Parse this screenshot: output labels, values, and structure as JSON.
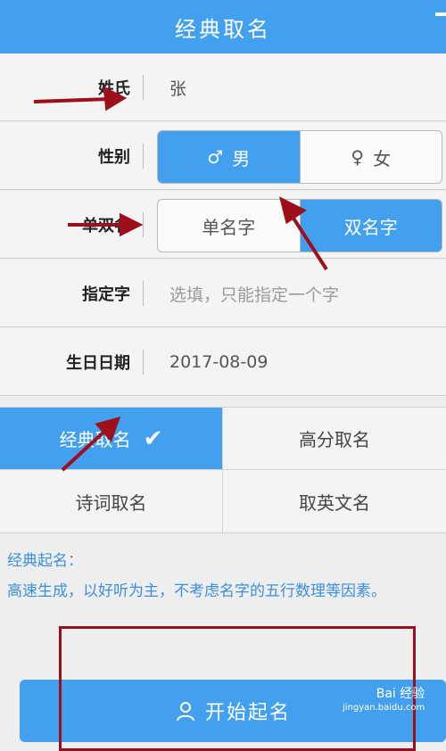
{
  "header": {
    "title": "经典取名"
  },
  "form": {
    "surname": {
      "label": "姓氏",
      "value": "张"
    },
    "gender": {
      "label": "性别",
      "options": [
        {
          "label": "男",
          "icon": "male-symbol-icon",
          "active": true
        },
        {
          "label": "女",
          "icon": "female-symbol-icon",
          "active": false
        }
      ]
    },
    "name_length": {
      "label": "单双名",
      "options": [
        {
          "label": "单名字",
          "active": false
        },
        {
          "label": "双名字",
          "active": true
        }
      ]
    },
    "specified_char": {
      "label": "指定字",
      "placeholder": "选填，只能指定一个字"
    },
    "birthday": {
      "label": "生日日期",
      "value": "2017-08-09"
    }
  },
  "tabs": [
    {
      "label": "经典取名",
      "active": true,
      "checked": true
    },
    {
      "label": "高分取名",
      "active": false
    },
    {
      "label": "诗词取名",
      "active": false
    },
    {
      "label": "取英文名",
      "active": false
    }
  ],
  "description": {
    "title": "经典起名：",
    "body": "高速生成，以好听为主，不考虑名字的五行数理等因素。"
  },
  "start_button": {
    "label": "开始起名",
    "icon": "person-icon"
  },
  "watermark": {
    "text": "Bai 经验",
    "sub": "jingyan.baidu.com"
  },
  "colors": {
    "primary": "#43a0ee",
    "annotation": "#9c0f1b",
    "description_text": "#3b8fe0"
  }
}
